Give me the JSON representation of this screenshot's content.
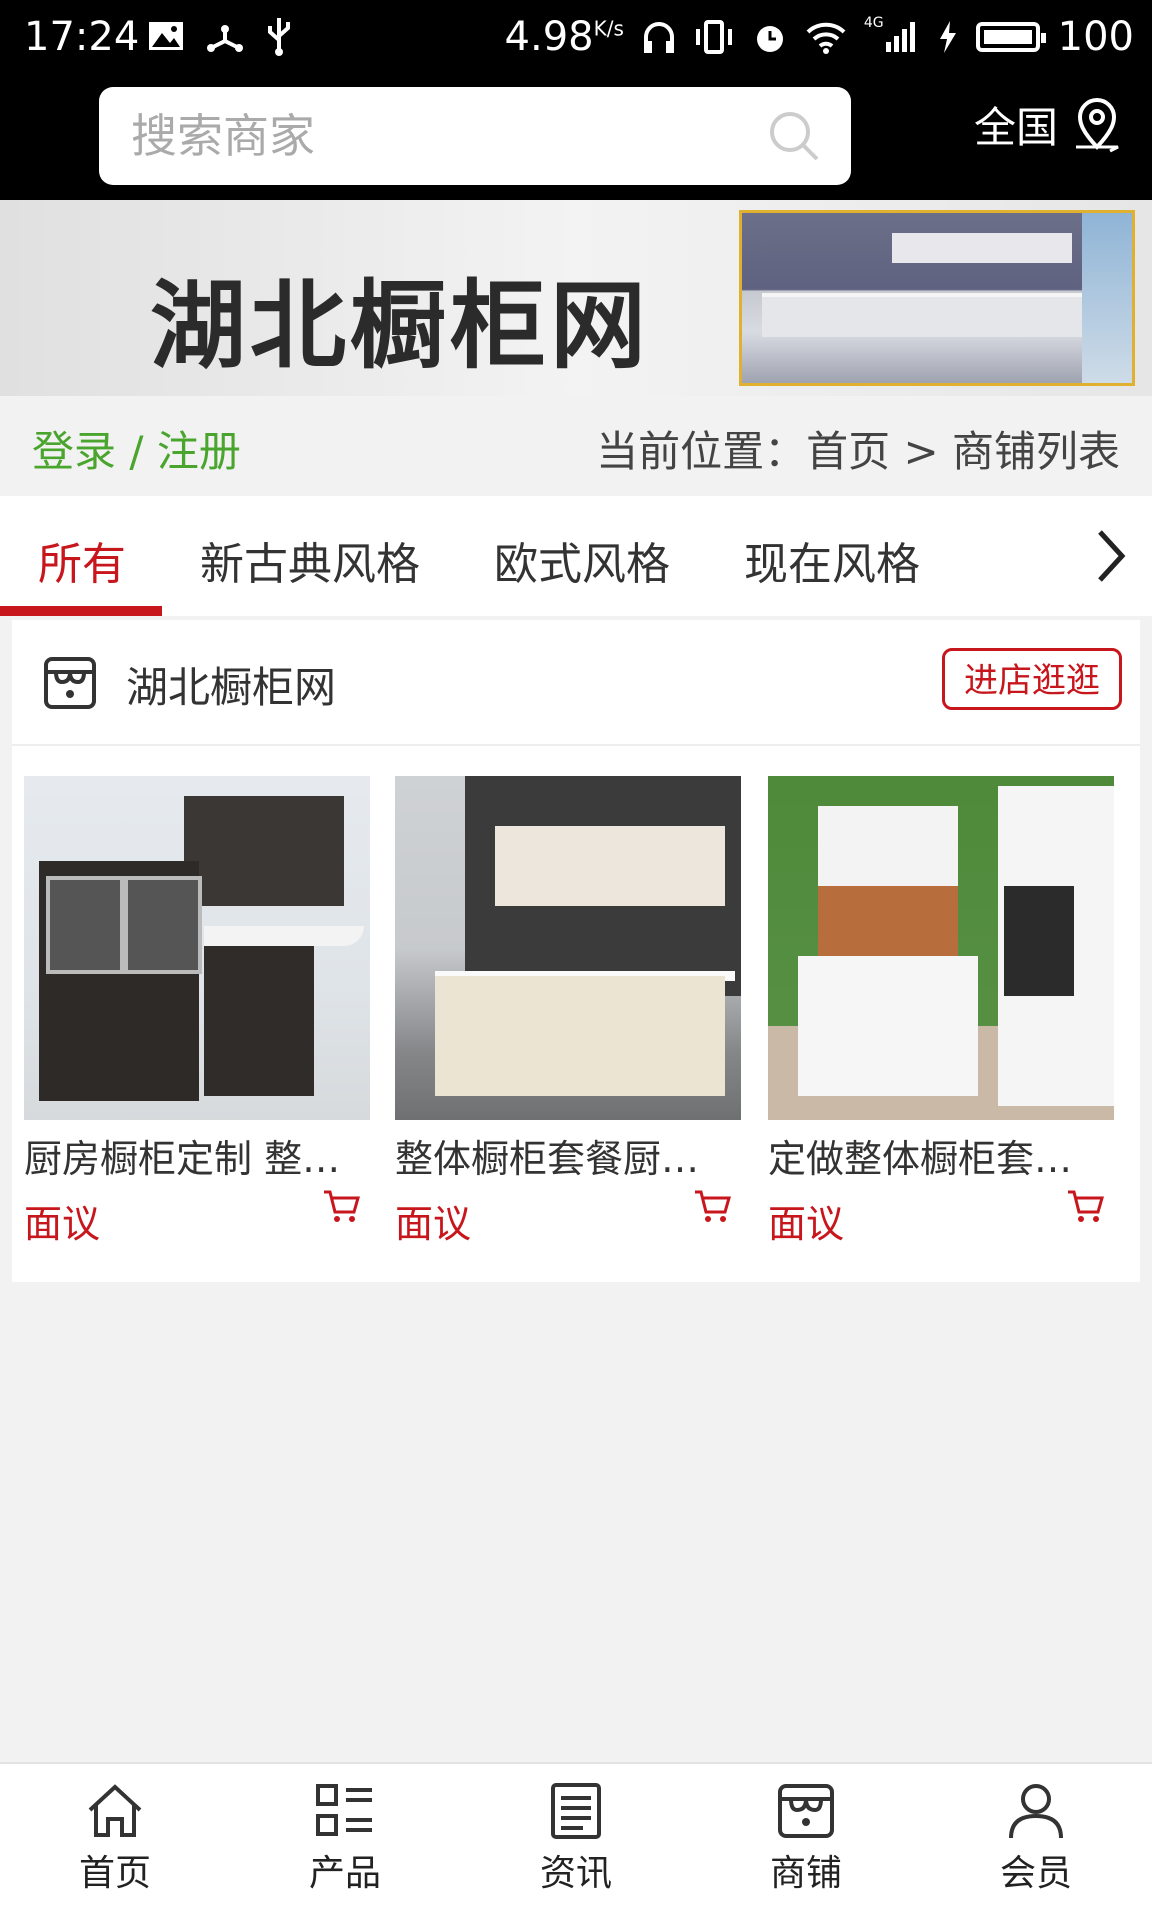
{
  "status_bar": {
    "time": "17:24",
    "speed": "4.98",
    "speed_unit": "K/s",
    "network": "4G",
    "battery": "100"
  },
  "search": {
    "placeholder": "搜索商家",
    "region_label": "全国"
  },
  "banner": {
    "title": "湖北橱柜网"
  },
  "account": {
    "login_register": "登录 / 注册"
  },
  "breadcrumb": {
    "text": "当前位置：首页 > 商铺列表"
  },
  "tabs": [
    {
      "label": "所有",
      "active": true
    },
    {
      "label": "新古典风格",
      "active": false
    },
    {
      "label": "欧式风格",
      "active": false
    },
    {
      "label": "现在风格",
      "active": false
    }
  ],
  "shop": {
    "name": "湖北橱柜网",
    "visit_button": "进店逛逛",
    "products": [
      {
        "name": "厨房橱柜定制 整体橱柜",
        "price": "面议"
      },
      {
        "name": "整体橱柜套餐厨房橱柜",
        "price": "面议"
      },
      {
        "name": "定做整体橱柜套餐厨房",
        "price": "面议"
      }
    ]
  },
  "bottom_nav": [
    {
      "label": "首页",
      "icon": "home-icon"
    },
    {
      "label": "产品",
      "icon": "grid-list-icon"
    },
    {
      "label": "资讯",
      "icon": "document-icon"
    },
    {
      "label": "商铺",
      "icon": "store-icon"
    },
    {
      "label": "会员",
      "icon": "user-icon"
    }
  ],
  "colors": {
    "accent": "#c8161d",
    "login_green": "#4aa52e",
    "topbar": "#000000"
  }
}
